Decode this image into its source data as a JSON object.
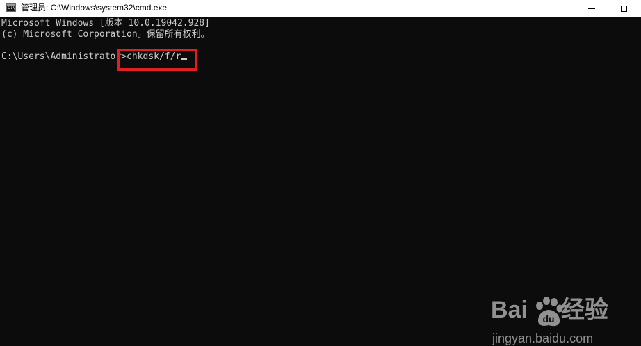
{
  "window": {
    "title": "管理员: C:\\Windows\\system32\\cmd.exe",
    "icon": "cmd-icon",
    "icon_text": "C:\\_"
  },
  "console": {
    "lines": [
      "Microsoft Windows [版本 10.0.19042.928]",
      "(c) Microsoft Corporation。保留所有权利。"
    ],
    "prompt": "C:\\Users\\Administrator>",
    "command": "chkdsk/f/r"
  },
  "watermark": {
    "logo_prefix": "Bai",
    "logo_suffix": "经验",
    "url": "jingyan.baidu.com",
    "paw_text": "du"
  },
  "colors": {
    "console_bg": "#0c0c0c",
    "console_text": "#cccccc",
    "highlight": "#e02020",
    "titlebar_bg": "#ffffff"
  }
}
